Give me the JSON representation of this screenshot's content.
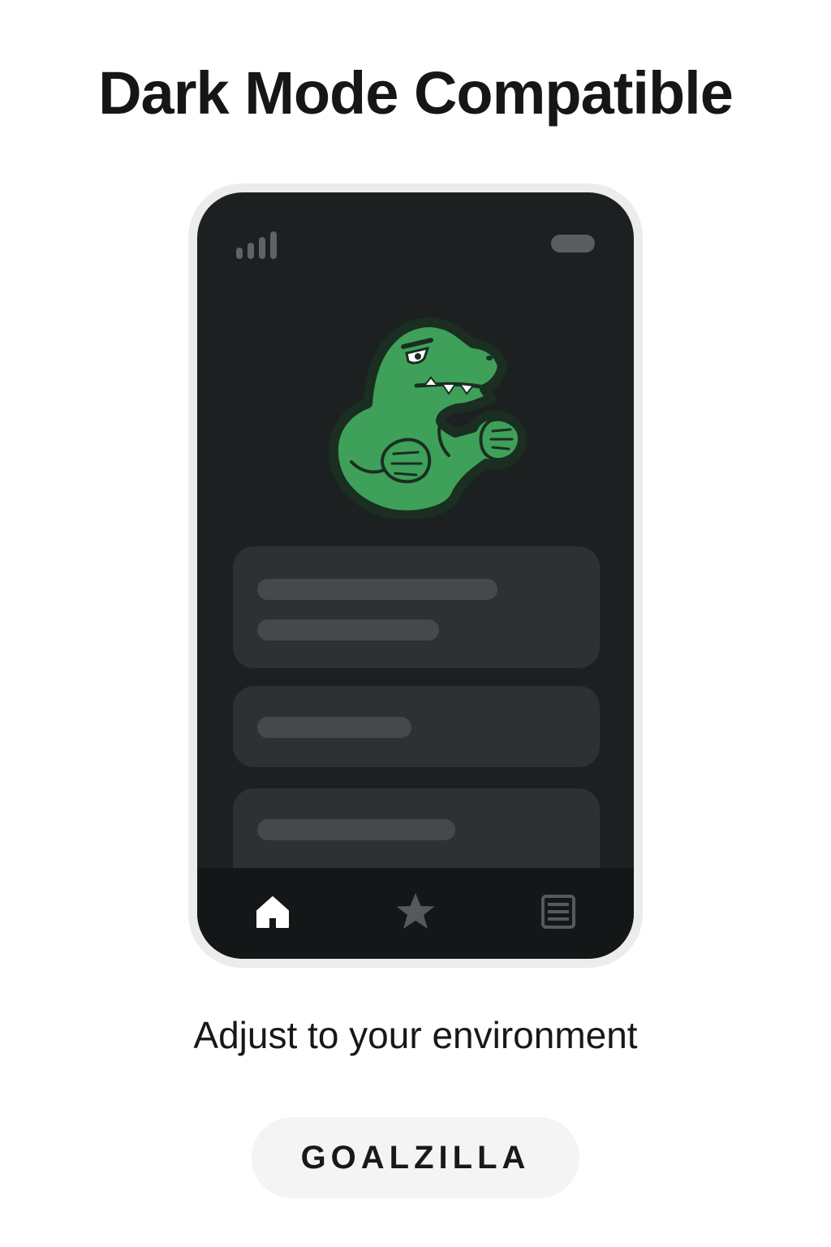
{
  "headline": "Dark Mode Compatible",
  "tagline": "Adjust to your environment",
  "brand_name": "GOALZILLA",
  "phone": {
    "status_bar": {
      "signal_icon": "signal-bars-icon",
      "battery_icon": "battery-pill-icon"
    },
    "mascot_icon": "green-dinosaur-mascot",
    "cards": [
      {
        "placeholder_lines": 2
      },
      {
        "placeholder_lines": 1
      },
      {
        "placeholder_lines": 1
      }
    ],
    "bottom_nav": [
      {
        "icon": "home-icon",
        "active": true
      },
      {
        "icon": "star-icon",
        "active": false
      },
      {
        "icon": "list-icon",
        "active": false
      }
    ]
  },
  "colors": {
    "background": "#ffffff",
    "screen": "#1d2021",
    "card": "#2e3132",
    "placeholder": "#46494b",
    "nav": "#141718",
    "mascot_green": "#3fa05a",
    "active_icon": "#ffffff",
    "inactive_icon": "#55595c"
  }
}
